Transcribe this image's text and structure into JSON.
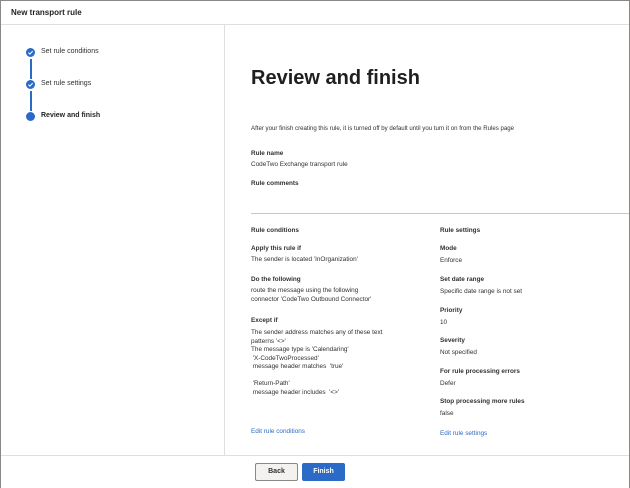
{
  "window": {
    "title": "New transport rule"
  },
  "steps": [
    {
      "label": "Set rule conditions",
      "state": "completed"
    },
    {
      "label": "Set rule settings",
      "state": "completed"
    },
    {
      "label": "Review and finish",
      "state": "current"
    }
  ],
  "page": {
    "heading": "Review and finish",
    "intro": "After your finish creating this rule, it is turned off by default until you turn it on from the Rules page",
    "rule_name_label": "Rule name",
    "rule_name_value": "CodeTwo Exchange transport rule",
    "rule_comments_label": "Rule comments"
  },
  "conditions": {
    "heading": "Rule conditions",
    "apply_label": "Apply this rule if",
    "apply_value": "The sender is located 'InOrganization'",
    "do_label": "Do the following",
    "do_value": "route the message using the following\nconnector 'CodeTwo Outbound Connector'",
    "except_label": "Except if",
    "except_value": "The sender address matches any of these text\npatterns '<>'\nThe message type is 'Calendaring'\n 'X-CodeTwoProcessed'\n message header matches  'true'\n\n 'Return-Path'\n message header includes  '<>'",
    "edit_link": "Edit rule conditions"
  },
  "settings": {
    "heading": "Rule settings",
    "mode_label": "Mode",
    "mode_value": "Enforce",
    "date_label": "Set date range",
    "date_value": "Specific date range is not set",
    "priority_label": "Priority",
    "priority_value": "10",
    "severity_label": "Severity",
    "severity_value": "Not specified",
    "errors_label": "For rule processing errors",
    "errors_value": "Defer",
    "stop_label": "Stop processing more rules",
    "stop_value": "false",
    "edit_link": "Edit rule settings"
  },
  "footer": {
    "back_label": "Back",
    "finish_label": "Finish"
  },
  "colors": {
    "accent": "#2b6ac6",
    "border": "#e1dfdd",
    "text": "#323130"
  }
}
